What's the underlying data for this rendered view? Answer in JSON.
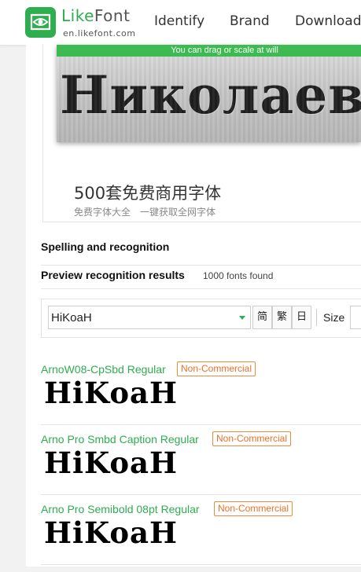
{
  "header": {
    "brand_like": "Like",
    "brand_font": "Font",
    "url": "en.likefont.com",
    "nav": [
      "Identify",
      "Brand",
      "Download"
    ]
  },
  "banner": {
    "drag_hint": "You can drag or scale at will",
    "preview_text": "Николаев"
  },
  "promo": {
    "title": "500套免费商用字体",
    "subtitle": "免费字体大全　一键获取全网字体"
  },
  "section": {
    "spelling_title": "Spelling and recognition",
    "results_title": "Preview recognition results",
    "results_count": "1000 fonts found"
  },
  "toolbar": {
    "text_value": "HiKoaH",
    "btn_simplified": "简",
    "btn_traditional": "繁",
    "btn_japanese": "日",
    "size_label": "Size"
  },
  "results": [
    {
      "name": "ArnoW08-CpSbd Regular",
      "badge": "Non-Commercial",
      "sample": "HiKoaH"
    },
    {
      "name": "Arno Pro Smbd Caption Regular",
      "badge": "Non-Commercial",
      "sample": "HiKoaH"
    },
    {
      "name": "Arno Pro Semibold 08pt Regular",
      "badge": "Non-Commercial",
      "sample": "HiKoaH"
    }
  ],
  "colors": {
    "accent": "#2eae4f",
    "badge": "#e8712a"
  },
  "icons": [
    "eye-logo-icon",
    "chevron-down-icon"
  ]
}
